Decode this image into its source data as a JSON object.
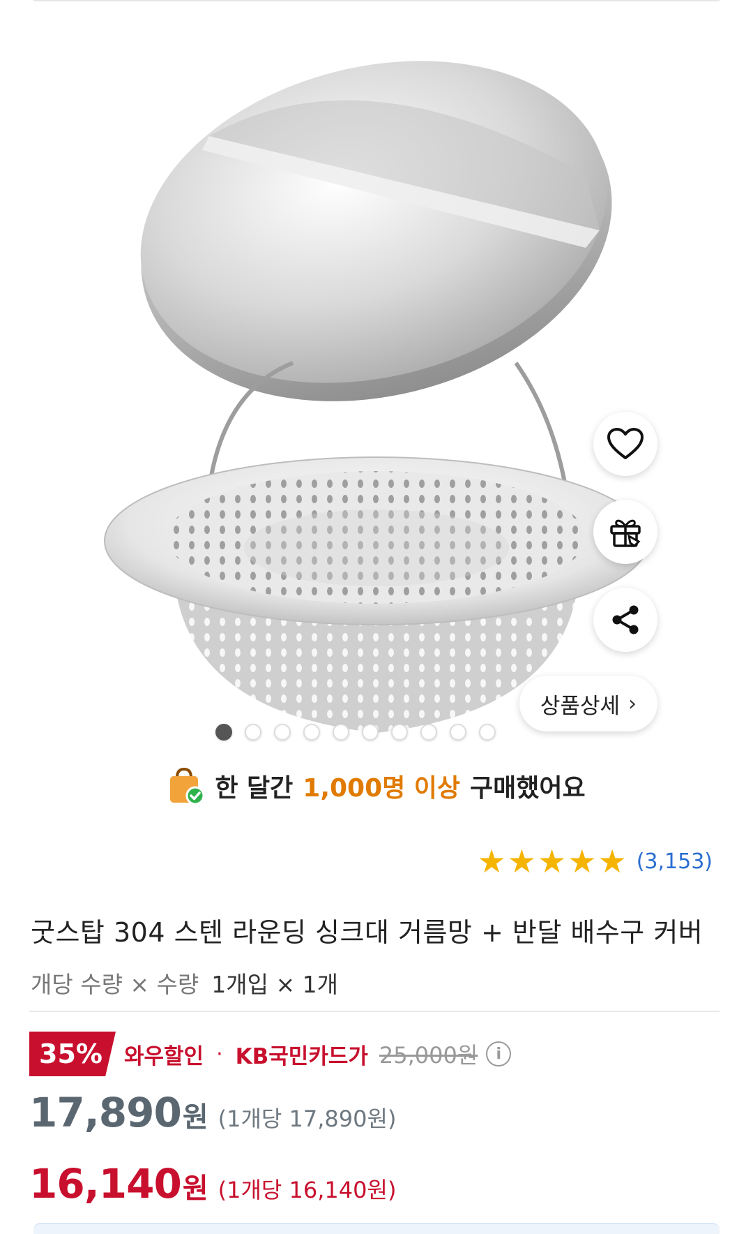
{
  "icons": {
    "like": "heart-icon",
    "gift": "gift-icon",
    "share": "share-icon",
    "detail_chevron": "chevron-right-icon",
    "bag": "shopping-bag-check-icon",
    "info": "info-icon"
  },
  "gallery": {
    "image_count": 10,
    "active_index": 0,
    "detail_label": "상품상세",
    "detail_chevron": "›"
  },
  "social_proof": {
    "prefix": "한 달간",
    "highlight": "1,000명 이상",
    "suffix": "구매했어요"
  },
  "rating": {
    "stars": 5,
    "review_count": "(3,153)"
  },
  "product": {
    "title": "굿스탑 304 스텐 라운딩 싱크대 거름망 + 반달 배수구 커버",
    "option_label": "개당 수량 × 수량",
    "option_value": "1개입 × 1개"
  },
  "pricing": {
    "discount_badge": "35%",
    "wow_label": "와우할인",
    "separator": "·",
    "card_label": "KB국민카드가",
    "original_price": "25,000원",
    "info_glyph": "i",
    "price1": "17,890",
    "price1_unit": "원",
    "price1_per": "(1개당 17,890원)",
    "price2": "16,140",
    "price2_unit": "원",
    "price2_per": "(1개당 16,140원)"
  },
  "colors": {
    "accent_red": "#c8102e",
    "highlight_orange": "#e07a00",
    "star": "#f5b400",
    "link_blue": "#2b6ed1"
  }
}
